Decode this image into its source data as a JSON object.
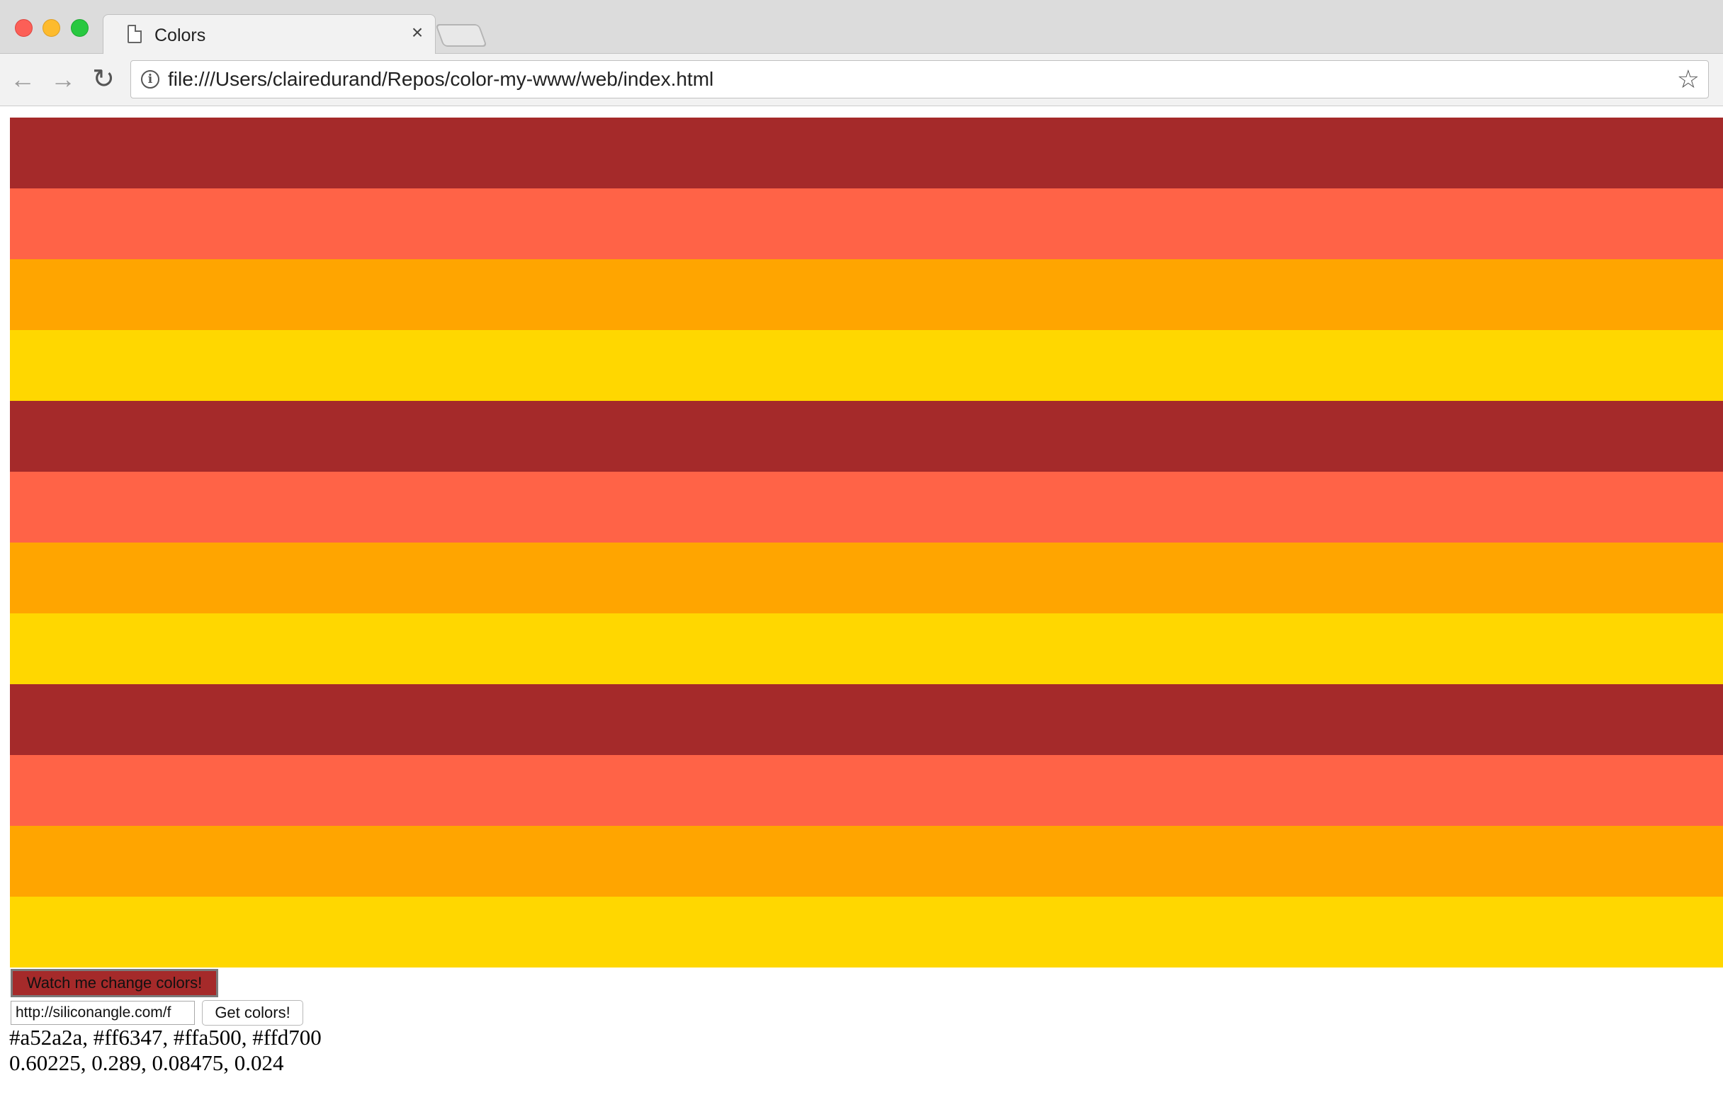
{
  "browser": {
    "tab_title": "Colors",
    "tab_close": "×",
    "url": "file:///Users/clairedurand/Repos/color-my-www/web/index.html",
    "icons": {
      "back": "←",
      "forward": "→",
      "reload": "↻",
      "info": "i",
      "star": "☆"
    }
  },
  "page": {
    "stripe_colors": [
      "#a52a2a",
      "#ff6347",
      "#ffa500",
      "#ffd700",
      "#a52a2a",
      "#ff6347",
      "#ffa500",
      "#ffd700",
      "#a52a2a",
      "#ff6347",
      "#ffa500",
      "#ffd700"
    ],
    "change_button": {
      "label": "Watch me change colors!",
      "background": "#a52a2a"
    },
    "url_input": {
      "value": "http://siliconangle.com/f"
    },
    "get_colors_button": {
      "label": "Get colors!"
    },
    "hex_output": "#a52a2a, #ff6347, #ffa500, #ffd700",
    "value_output": "0.60225, 0.289, 0.08475, 0.024"
  }
}
